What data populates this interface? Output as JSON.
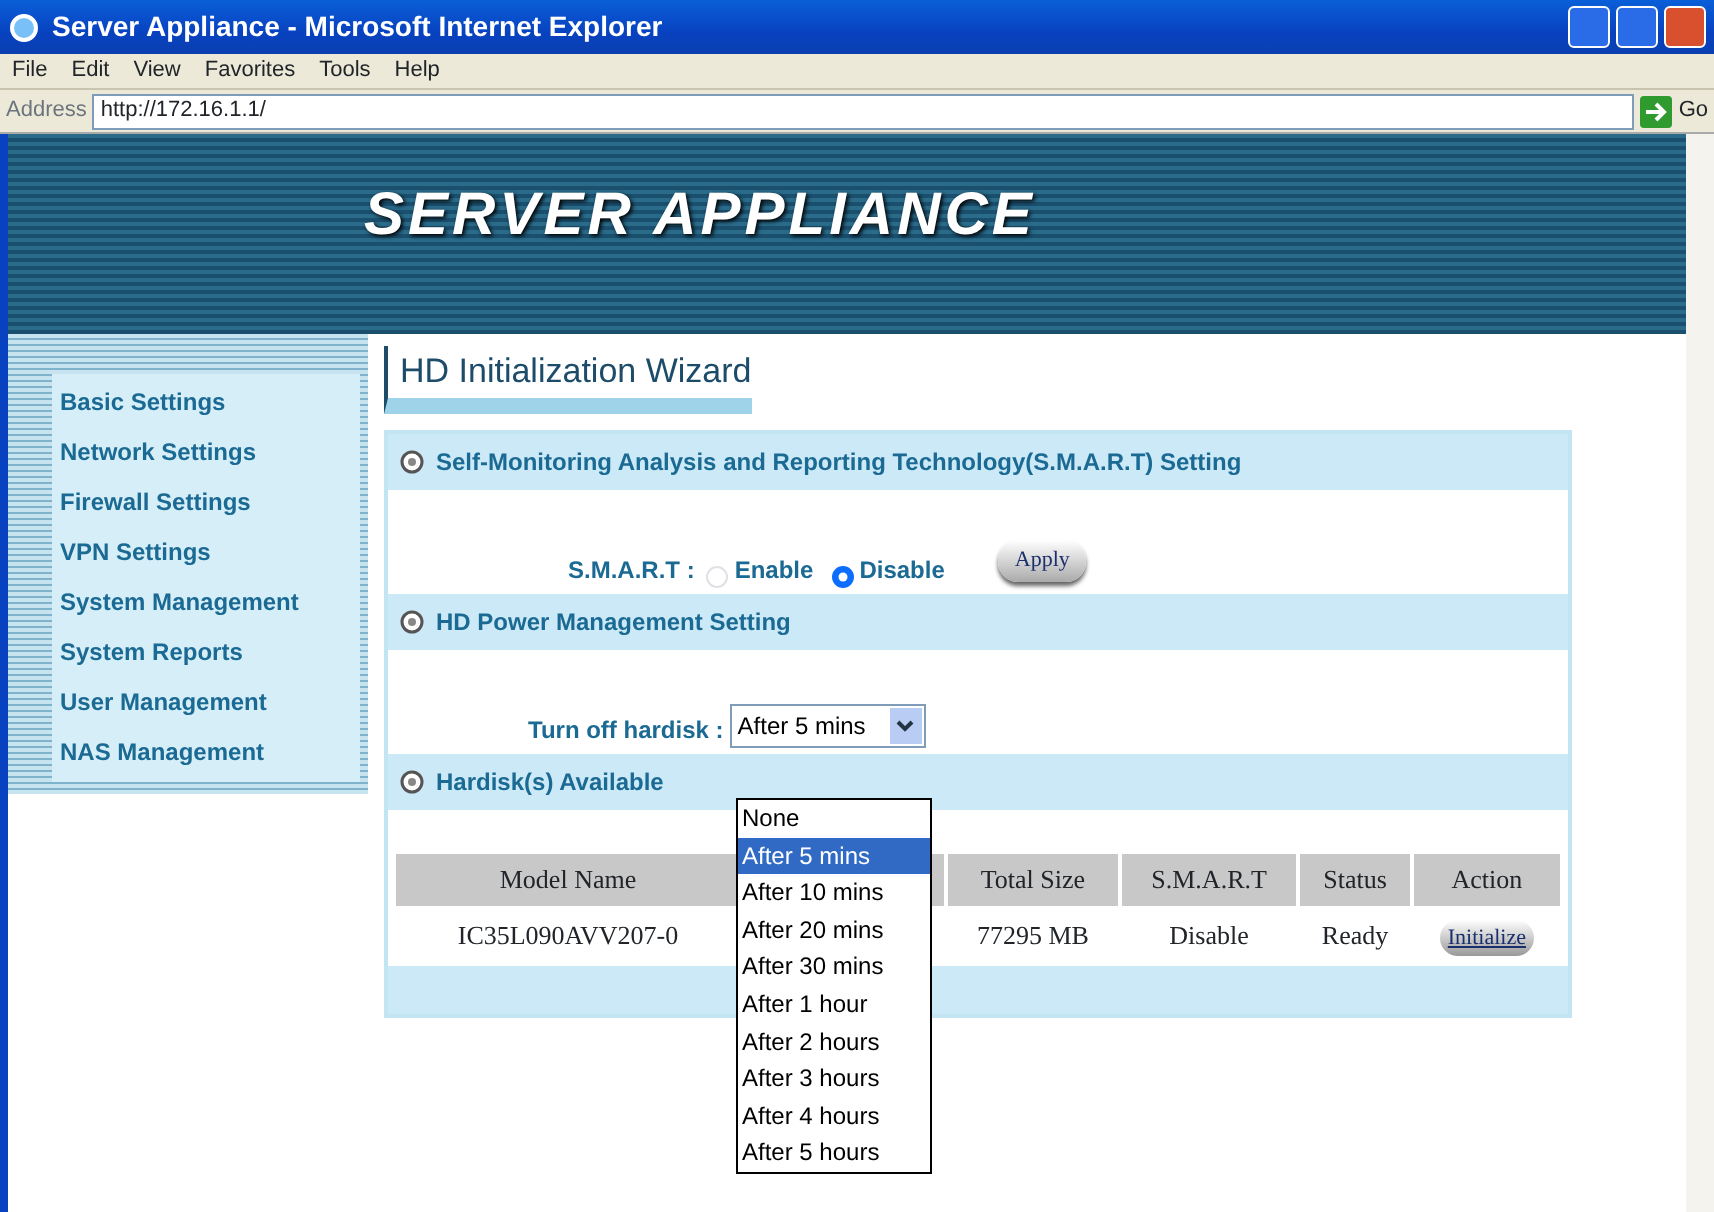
{
  "window": {
    "title": "Server Appliance - Microsoft Internet Explorer"
  },
  "menu": [
    "File",
    "Edit",
    "View",
    "Favorites",
    "Tools",
    "Help"
  ],
  "address": {
    "label": "Address",
    "url": "http://172.16.1.1/",
    "go": "Go"
  },
  "banner": {
    "title": "SERVER APPLIANCE"
  },
  "sidebar": {
    "items": [
      {
        "label": "Basic Settings"
      },
      {
        "label": "Network Settings"
      },
      {
        "label": "Firewall Settings"
      },
      {
        "label": "VPN Settings"
      },
      {
        "label": "System Management"
      },
      {
        "label": "System Reports"
      },
      {
        "label": "User Management"
      },
      {
        "label": "NAS Management"
      }
    ]
  },
  "page_title": "HD Initialization Wizard",
  "smart_section": {
    "heading": "Self-Monitoring Analysis and Reporting Technology(S.M.A.R.T) Setting",
    "label": "S.M.A.R.T :",
    "options": [
      {
        "label": "Enable",
        "selected": false
      },
      {
        "label": "Disable",
        "selected": true
      }
    ],
    "apply": "Apply"
  },
  "power_section": {
    "heading": "HD Power Management Setting",
    "label": "Turn off hardisk :",
    "value": "After 5 mins",
    "expanded": true,
    "options": [
      {
        "label": "None",
        "selected": false
      },
      {
        "label": "After 5 mins",
        "selected": true
      },
      {
        "label": "After 10 mins",
        "selected": false
      },
      {
        "label": "After 20 mins",
        "selected": false
      },
      {
        "label": "After 30 mins",
        "selected": false
      },
      {
        "label": "After 1 hour",
        "selected": false
      },
      {
        "label": "After 2 hours",
        "selected": false
      },
      {
        "label": "After 3 hours",
        "selected": false
      },
      {
        "label": "After 4 hours",
        "selected": false
      },
      {
        "label": "After 5 hours",
        "selected": false
      }
    ]
  },
  "disks_section": {
    "heading": "Hardisk(s) Available",
    "table": {
      "columns": [
        "Model Name",
        "Total Size",
        "S.M.A.R.T",
        "Status",
        "Action"
      ],
      "rows": [
        {
          "model": "IC35L090AVV207-0",
          "size": "77295 MB",
          "smart": "Disable",
          "status": "Ready",
          "action": "Initialize"
        }
      ]
    }
  }
}
